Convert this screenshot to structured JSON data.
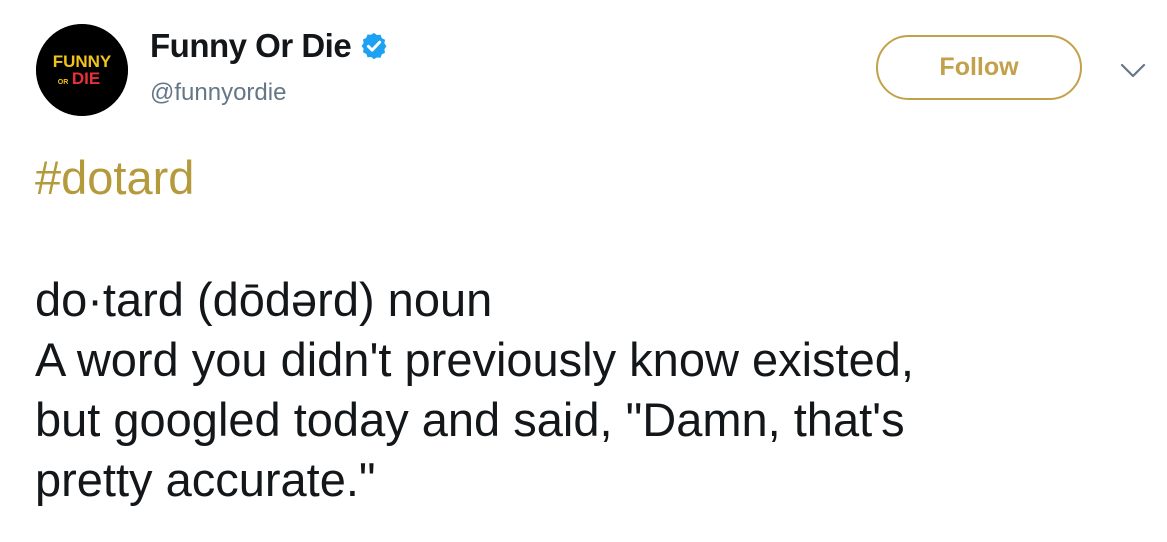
{
  "author": {
    "avatar_text_top": "FUNNY",
    "avatar_text_or": "OR",
    "avatar_text_bottom": "DIE",
    "display_name": "Funny Or Die",
    "handle": "@funnyordie",
    "verified": true
  },
  "actions": {
    "follow_label": "Follow"
  },
  "icons": {
    "verified": "verified-badge-icon",
    "menu": "chevron-down-icon"
  },
  "tweet": {
    "hashtag": "#dotard",
    "lines": [
      "do·tard (dōdərd) noun",
      "A word you didn't previously know existed,",
      "but googled today and said, \"Damn, that's",
      "pretty accurate.\""
    ]
  },
  "colors": {
    "accent": "#c3a14a",
    "hashtag": "#b59a3c",
    "text": "#14171a",
    "secondary_text": "#657786",
    "verified": "#1da1f2"
  }
}
